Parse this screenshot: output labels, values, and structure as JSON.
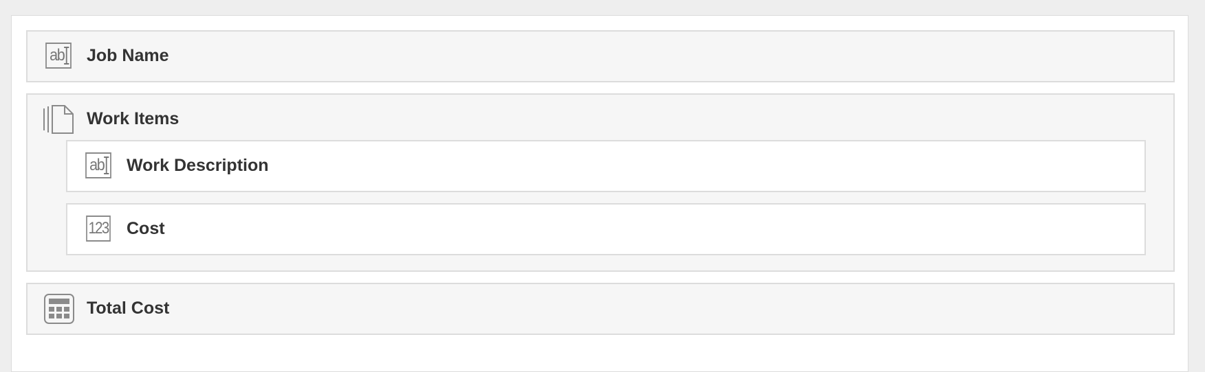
{
  "fields": {
    "job_name": {
      "label": "Job Name",
      "icon": "text-field-icon"
    },
    "work_items": {
      "label": "Work Items",
      "icon": "repeater-icon",
      "children": [
        {
          "label": "Work Description",
          "icon": "text-field-icon"
        },
        {
          "label": "Cost",
          "icon": "number-field-icon"
        }
      ]
    },
    "total_cost": {
      "label": "Total Cost",
      "icon": "calculator-icon"
    }
  },
  "icon_text": {
    "text_field": "ab",
    "number_field": "123"
  },
  "colors": {
    "page_bg": "#eeeeee",
    "field_bg": "#f6f6f6",
    "border": "#dcdcdc",
    "label": "#333333",
    "icon": "#8a8a8a"
  }
}
